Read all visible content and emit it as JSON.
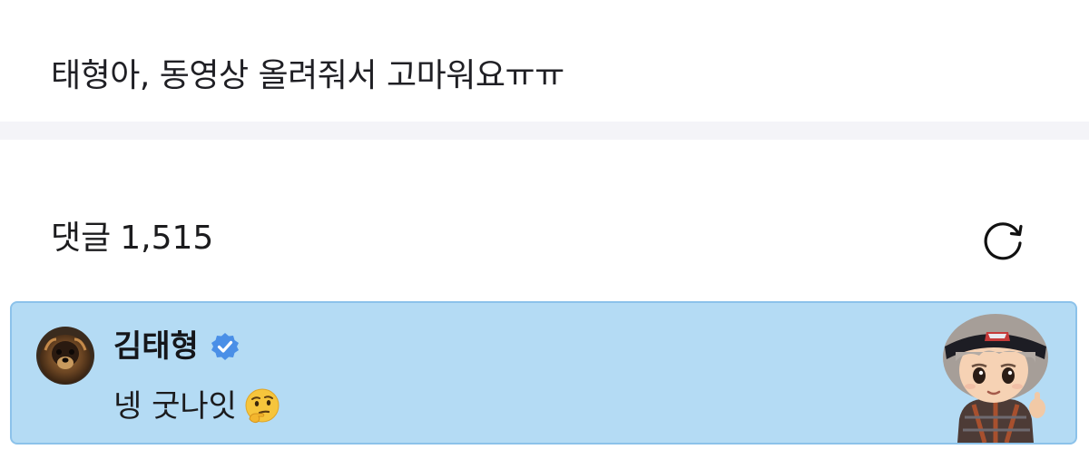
{
  "post": {
    "text": "태형아, 동영상 올려줘서 고마워요ㅠㅠ"
  },
  "comments": {
    "label": "댓글",
    "count": "1,515",
    "refresh_icon": "refresh-icon"
  },
  "pinned_comment": {
    "author": "김태형",
    "verified_icon": "verified-badge-icon",
    "text": "넹 굿나잇",
    "emoji": "thinking-face",
    "highlight_color": "#b4dbf4",
    "border_color": "#8cc2ea",
    "badge_color": "#4a8fe7",
    "avatar": "avatar-dog-photo",
    "sticker": "character-sticker"
  }
}
